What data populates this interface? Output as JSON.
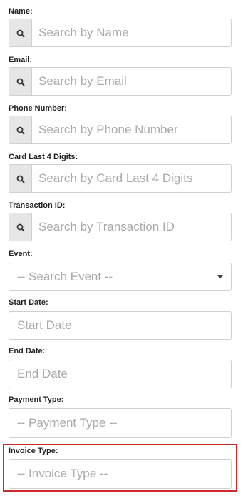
{
  "fields": {
    "name": {
      "label": "Name:",
      "placeholder": "Search by Name",
      "icon": "search-icon"
    },
    "email": {
      "label": "Email:",
      "placeholder": "Search by Email",
      "icon": "search-icon"
    },
    "phone": {
      "label": "Phone Number:",
      "placeholder": "Search by Phone Number",
      "icon": "search-icon"
    },
    "card": {
      "label": "Card Last 4 Digits:",
      "placeholder": "Search by Card Last 4 Digits",
      "icon": "search-icon"
    },
    "transaction": {
      "label": "Transaction ID:",
      "placeholder": "Search by Transaction ID",
      "icon": "search-icon"
    },
    "event": {
      "label": "Event:",
      "placeholder": "-- Search Event --",
      "icon": "caret-down-icon"
    },
    "start_date": {
      "label": "Start Date:",
      "placeholder": "Start Date"
    },
    "end_date": {
      "label": "End Date:",
      "placeholder": "End Date"
    },
    "payment_type": {
      "label": "Payment Type:",
      "placeholder": "-- Payment Type --"
    },
    "invoice_type": {
      "label": "Invoice Type:",
      "placeholder": "-- Invoice Type --"
    }
  },
  "colors": {
    "highlight": "#cc2a2a",
    "addon_bg": "#e6e6e6",
    "border": "#cfcfcf",
    "placeholder": "#a9a9a9"
  }
}
